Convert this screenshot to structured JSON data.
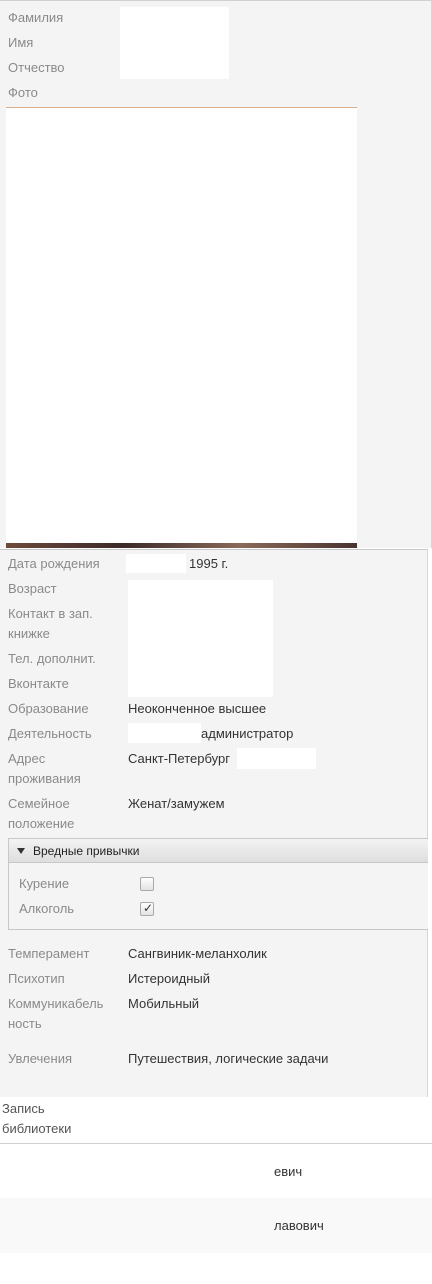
{
  "personal": {
    "surname_label": "Фамилия",
    "name_label": "Имя",
    "patronymic_label": "Отчество",
    "photo_label": "Фото"
  },
  "details": {
    "birth_label": "Дата рождения",
    "birth_value": "1995 г.",
    "age_label": "Возраст",
    "contact_label": "Контакт в зап. книжке",
    "phone_label": "Тел. дополнит.",
    "vk_label": "Вконтакте",
    "education_label": "Образование",
    "education_value": "Неоконченное высшее",
    "activity_label": "Деятельность",
    "activity_value": "администратор",
    "address_label": "Адрес проживания",
    "address_value": "Санкт-Петербург",
    "family_label": "Семейное положение",
    "family_value": "Женат/замужем"
  },
  "habits": {
    "title": "Вредные привычки",
    "smoking_label": "Курение",
    "smoking_checked": false,
    "alcohol_label": "Алкоголь",
    "alcohol_checked": true
  },
  "traits": {
    "temperament_label": "Темперамент",
    "temperament_value": "Сангвиник-меланхолик",
    "psychotype_label": "Психотип",
    "psychotype_value": "Истероидный",
    "sociability_label": "Коммуникабельность",
    "sociability_value": "Мобильный",
    "hobbies_label": "Увлечения",
    "hobbies_value": "Путешествия, логические задачи"
  },
  "library": {
    "label": "Запись библиотеки",
    "rows": [
      "евич",
      "лавович"
    ]
  }
}
